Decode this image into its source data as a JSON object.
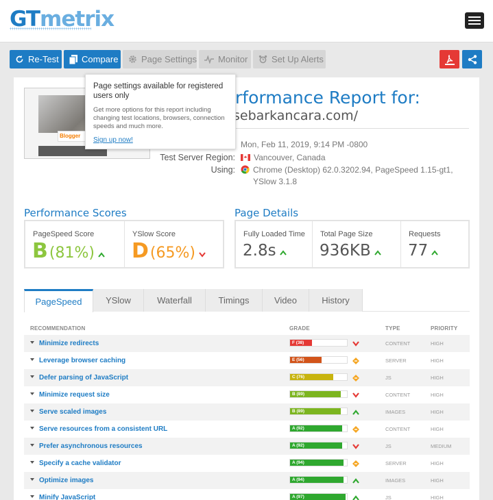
{
  "brand": {
    "gt": "GT",
    "metrix": "metrix"
  },
  "toolbar": {
    "retest": "Re-Test",
    "compare": "Compare",
    "page_settings": "Page Settings",
    "monitor": "Monitor",
    "alerts": "Set Up Alerts"
  },
  "tooltip": {
    "title": "Page settings available for registered users only",
    "body": "Get more options for this report including changing test locations, browsers, connection speeds and much more.",
    "link": "Sign up now!"
  },
  "thumbnail": {
    "blog_text": "Blogger"
  },
  "report": {
    "title": "rformance Report for:",
    "url": "sebarkancara.com/",
    "tested_value": "Mon, Feb 11, 2019, 9:14 PM -0800",
    "region_label": "Test Server Region:",
    "region_value": "Vancouver, Canada",
    "using_label": "Using:",
    "using_value": "Chrome (Desktop) 62.0.3202.94, PageSpeed 1.15-gt1,",
    "using_value2": "YSlow 3.1.8"
  },
  "scores": {
    "title": "Performance Scores",
    "pagespeed_label": "PageSpeed Score",
    "pagespeed_grade": "B",
    "pagespeed_pct": "(81%)",
    "yslow_label": "YSlow Score",
    "yslow_grade": "D",
    "yslow_pct": "(65%)"
  },
  "details": {
    "title": "Page Details",
    "loaded_label": "Fully Loaded Time",
    "loaded_value": "2.8s",
    "size_label": "Total Page Size",
    "size_value": "936KB",
    "requests_label": "Requests",
    "requests_value": "77"
  },
  "tabs": [
    "PageSpeed",
    "YSlow",
    "Waterfall",
    "Timings",
    "Video",
    "History"
  ],
  "table": {
    "headers": {
      "recommendation": "RECOMMENDATION",
      "grade": "GRADE",
      "type": "TYPE",
      "priority": "PRIORITY"
    },
    "rows": [
      {
        "name": "Minimize redirects",
        "grade": "F (38)",
        "pct": 38,
        "color": "#e53935",
        "trend": "down",
        "type": "CONTENT",
        "priority": "HIGH"
      },
      {
        "name": "Leverage browser caching",
        "grade": "E (56)",
        "pct": 56,
        "color": "#d2541a",
        "trend": "same",
        "type": "SERVER",
        "priority": "HIGH"
      },
      {
        "name": "Defer parsing of JavaScript",
        "grade": "C (76)",
        "pct": 76,
        "color": "#c8b40e",
        "trend": "same",
        "type": "JS",
        "priority": "HIGH"
      },
      {
        "name": "Minimize request size",
        "grade": "B (89)",
        "pct": 89,
        "color": "#7cb51f",
        "trend": "down",
        "type": "CONTENT",
        "priority": "HIGH"
      },
      {
        "name": "Serve scaled images",
        "grade": "B (89)",
        "pct": 89,
        "color": "#7cb51f",
        "trend": "up",
        "type": "IMAGES",
        "priority": "HIGH"
      },
      {
        "name": "Serve resources from a consistent URL",
        "grade": "A (92)",
        "pct": 92,
        "color": "#2fa82f",
        "trend": "same",
        "type": "CONTENT",
        "priority": "HIGH"
      },
      {
        "name": "Prefer asynchronous resources",
        "grade": "A (92)",
        "pct": 92,
        "color": "#2fa82f",
        "trend": "down",
        "type": "JS",
        "priority": "MEDIUM"
      },
      {
        "name": "Specify a cache validator",
        "grade": "A (94)",
        "pct": 94,
        "color": "#2fa82f",
        "trend": "same",
        "type": "SERVER",
        "priority": "HIGH"
      },
      {
        "name": "Optimize images",
        "grade": "A (94)",
        "pct": 94,
        "color": "#2fa82f",
        "trend": "up",
        "type": "IMAGES",
        "priority": "HIGH"
      },
      {
        "name": "Minify JavaScript",
        "grade": "A (97)",
        "pct": 97,
        "color": "#2fa82f",
        "trend": "up",
        "type": "JS",
        "priority": "HIGH"
      }
    ]
  },
  "colors": {
    "accent": "#1e7cc4",
    "grade_b": "#8dc63f",
    "grade_d": "#f59a23",
    "trend_up": "#2fa82f",
    "trend_down": "#e53935",
    "trend_same": "#f5a623"
  }
}
